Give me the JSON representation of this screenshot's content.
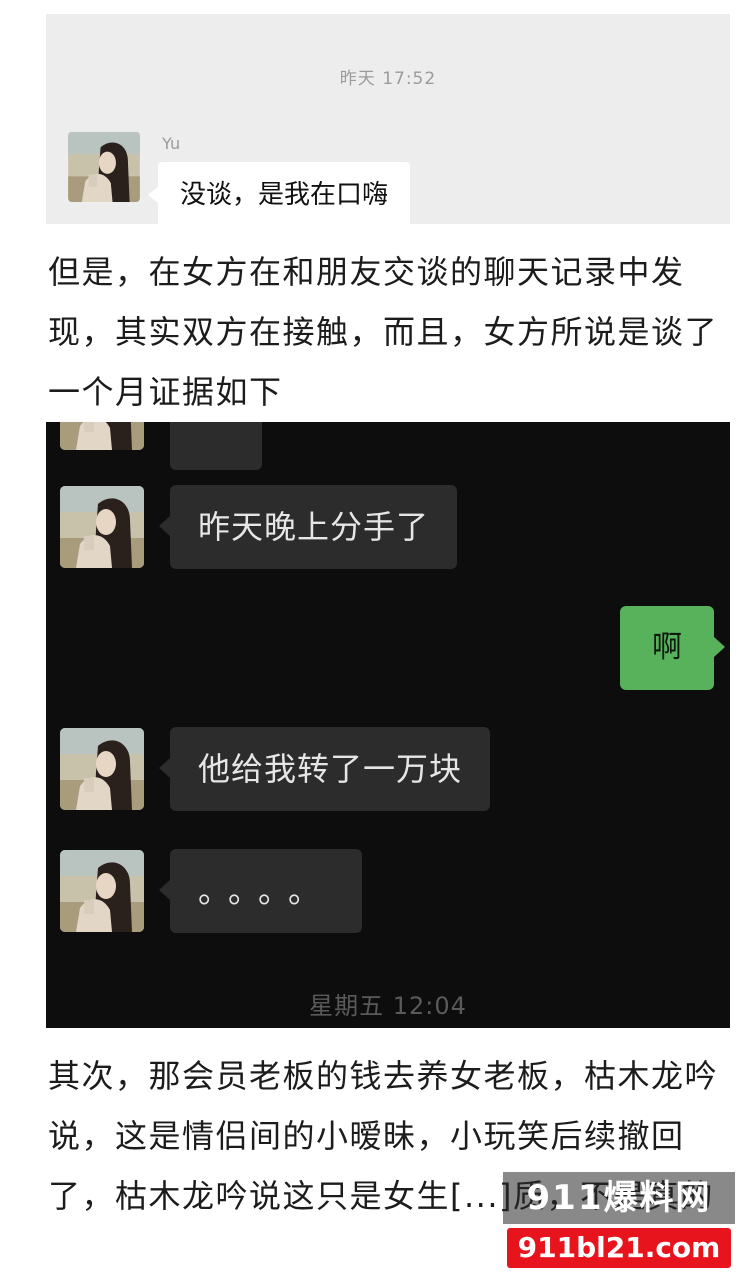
{
  "top_chat": {
    "timestamp": "昨天 17:52",
    "sender_name": "Yu",
    "message": "没谈，是我在口嗨"
  },
  "paragraph_1": "但是，在女方在和朋友交谈的聊天记录中发现，其实双方在接触，而且，女方所说是谈了一个月证据如下",
  "dark_chat": {
    "messages": [
      {
        "from": "other",
        "text": ""
      },
      {
        "from": "other",
        "text": "昨天晚上分手了"
      },
      {
        "from": "self",
        "text": "啊"
      },
      {
        "from": "other",
        "text": "他给我转了一万块"
      },
      {
        "from": "other",
        "text": "。。。。"
      }
    ],
    "timestamp": "星期五 12:04"
  },
  "paragraph_2": "其次，那会员老板的钱去养女老板，枯木龙吟说，这是情侣间的小暧昧，小玩笑后续撤回了，枯木龙吟说这只是女生[...]质，不是真的",
  "watermark": {
    "top_text": "911爆料网",
    "bottom_text": "911bl21.com"
  },
  "colors": {
    "self_bubble": "#58b15b",
    "dark_bubble": "#2c2c2c",
    "dark_background": "#0d0d0d",
    "watermark_red": "#e8141d"
  }
}
